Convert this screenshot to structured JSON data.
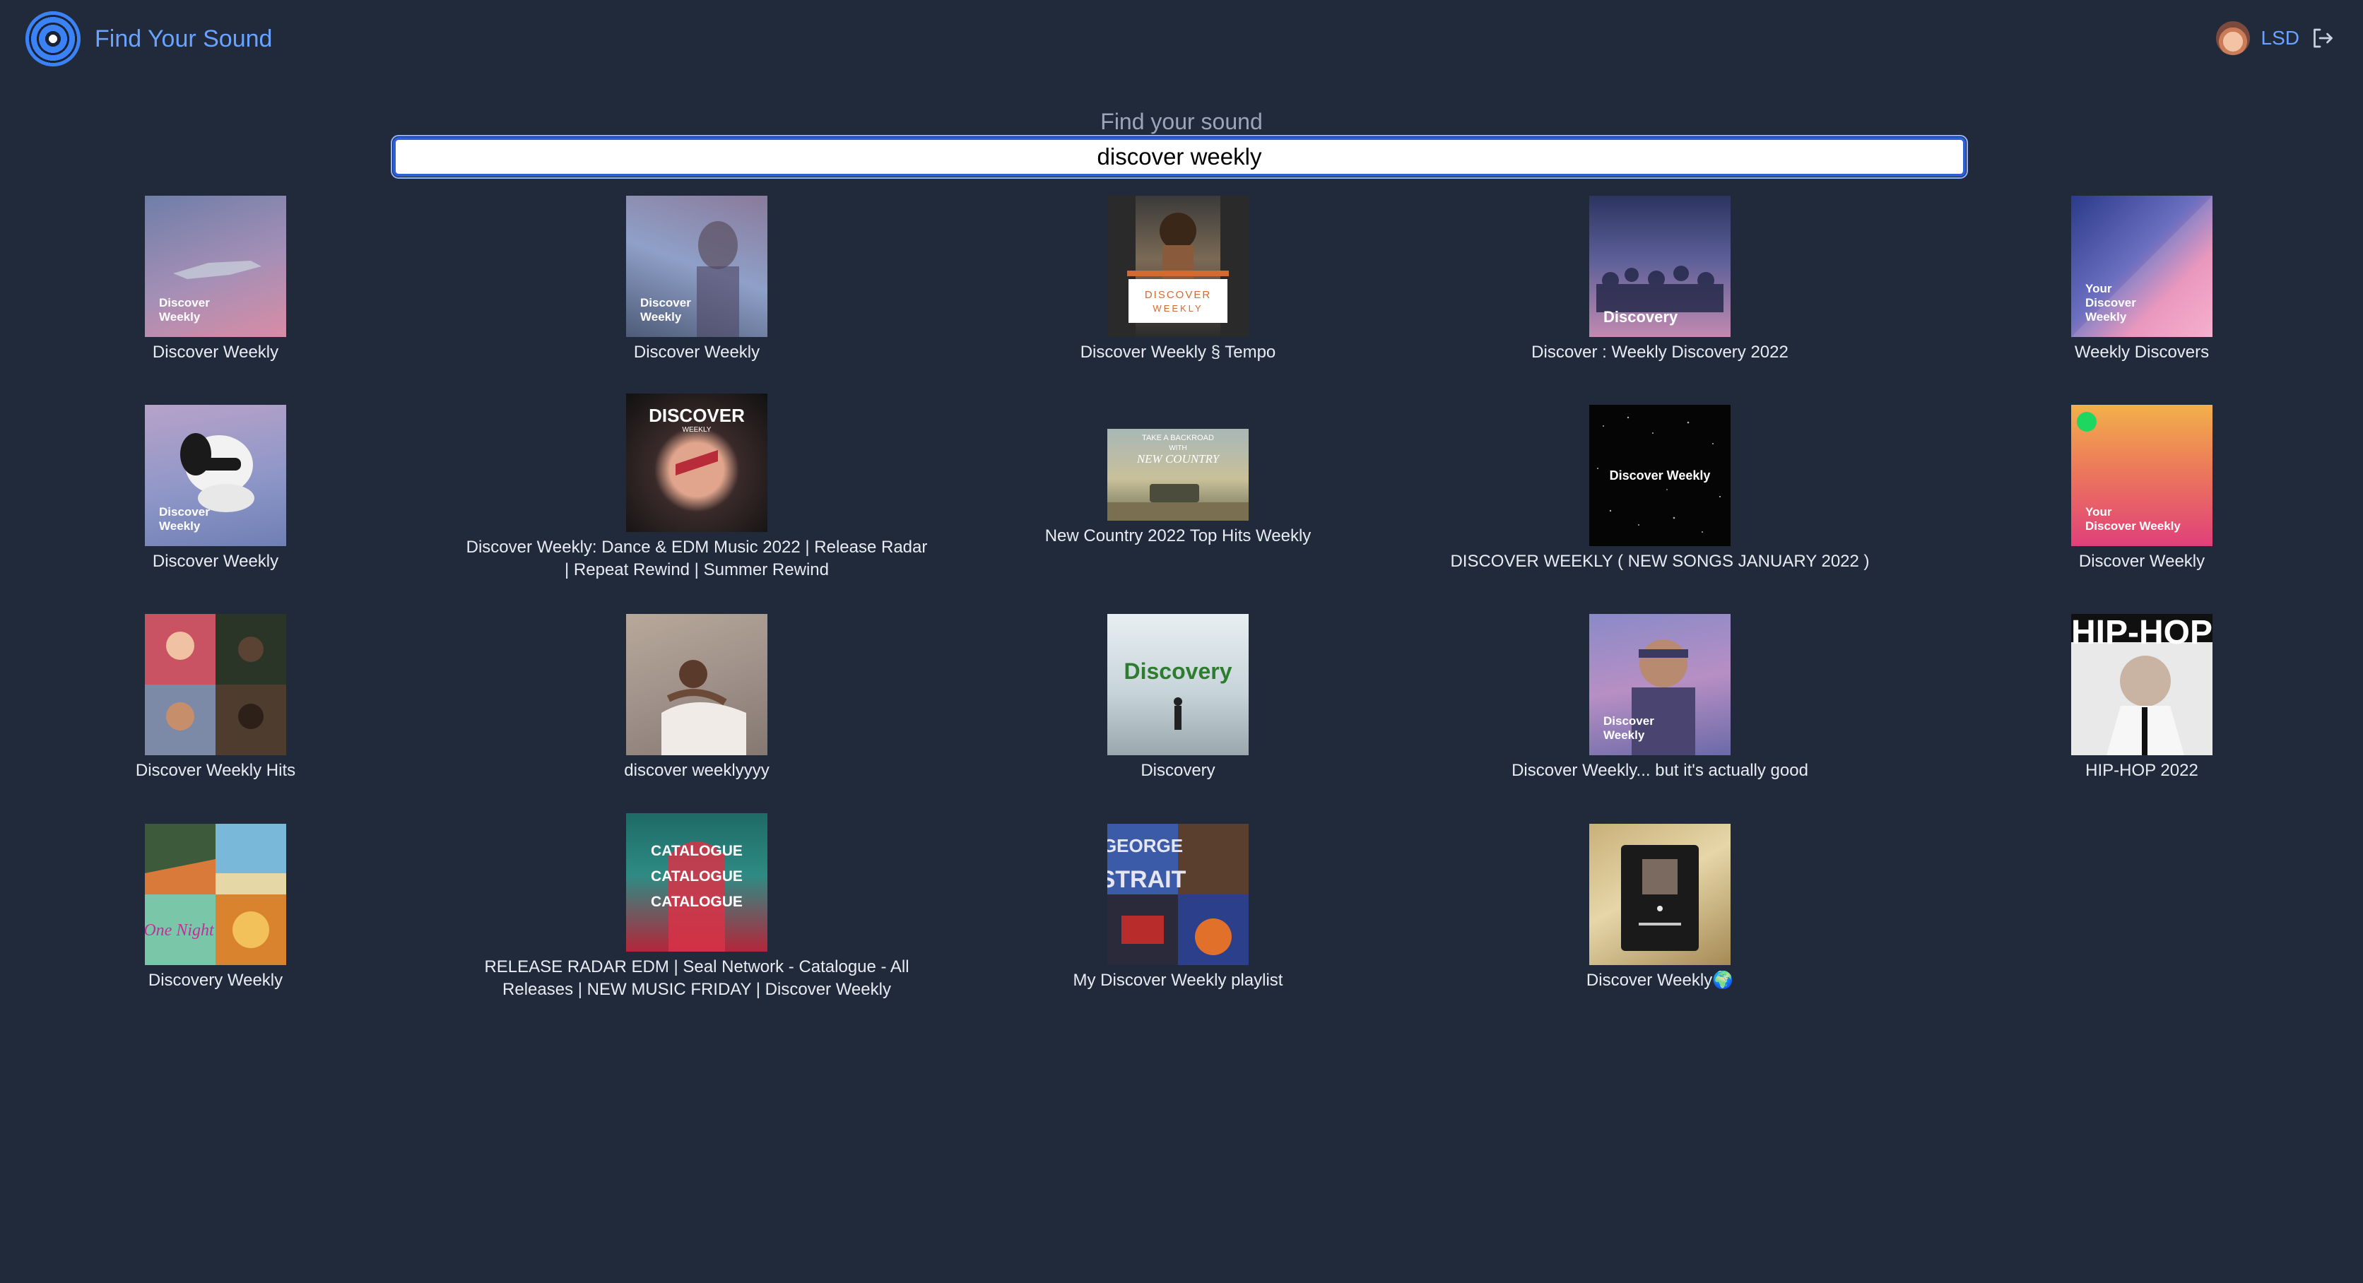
{
  "app": {
    "title": "Find Your Sound",
    "user": "LSD"
  },
  "search": {
    "label": "Find your sound",
    "value": "discover weekly",
    "placeholder": ""
  },
  "results": [
    {
      "title": "Discover Weekly",
      "cover_text": "Discover\nWeekly"
    },
    {
      "title": "Discover Weekly",
      "cover_text": "Discover\nWeekly"
    },
    {
      "title": "Discover Weekly § Tempo",
      "cover_text": "DISCOVER\nWEEKLY"
    },
    {
      "title": "Discover : Weekly Discovery 2022",
      "cover_text": "Discovery"
    },
    {
      "title": "Weekly Discovers",
      "cover_text": "Your\nDiscover\nWeekly"
    },
    {
      "title": "Discover Weekly",
      "cover_text": "Discover\nWeekly"
    },
    {
      "title": "Discover Weekly: Dance & EDM Music 2022 | Release Radar | Repeat Rewind | Summer Rewind",
      "cover_text": "DISCOVER"
    },
    {
      "title": "New Country 2022 Top Hits Weekly",
      "cover_text": "TAKE A BACKROAD WITH NEW COUNTRY"
    },
    {
      "title": "DISCOVER WEEKLY ( NEW SONGS JANUARY 2022 )",
      "cover_text": "Discover Weekly"
    },
    {
      "title": "Discover Weekly",
      "cover_text": "Your\nDiscover Weekly"
    },
    {
      "title": "Discover Weekly Hits",
      "cover_text": ""
    },
    {
      "title": "discover weeklyyyy",
      "cover_text": ""
    },
    {
      "title": "Discovery",
      "cover_text": "Discovery"
    },
    {
      "title": "Discover Weekly... but it's actually good",
      "cover_text": "Discover\nWeekly"
    },
    {
      "title": "HIP-HOP 2022",
      "cover_text": "HIP-HOP"
    },
    {
      "title": "Discovery Weekly",
      "cover_text": ""
    },
    {
      "title": "RELEASE RADAR EDM | Seal Network - Catalogue - All Releases | NEW MUSIC FRIDAY | Discover Weekly",
      "cover_text": "CATALOGUE\nCATALOGUE\nCATALOGUE"
    },
    {
      "title": "My Discover Weekly playlist",
      "cover_text": "GEORGE STRAIT"
    },
    {
      "title": "Discover Weekly🌍",
      "cover_text": ""
    }
  ],
  "colors": {
    "background": "#212a3b",
    "accent": "#6aa2ff",
    "input_border": "#2d5fd6"
  }
}
